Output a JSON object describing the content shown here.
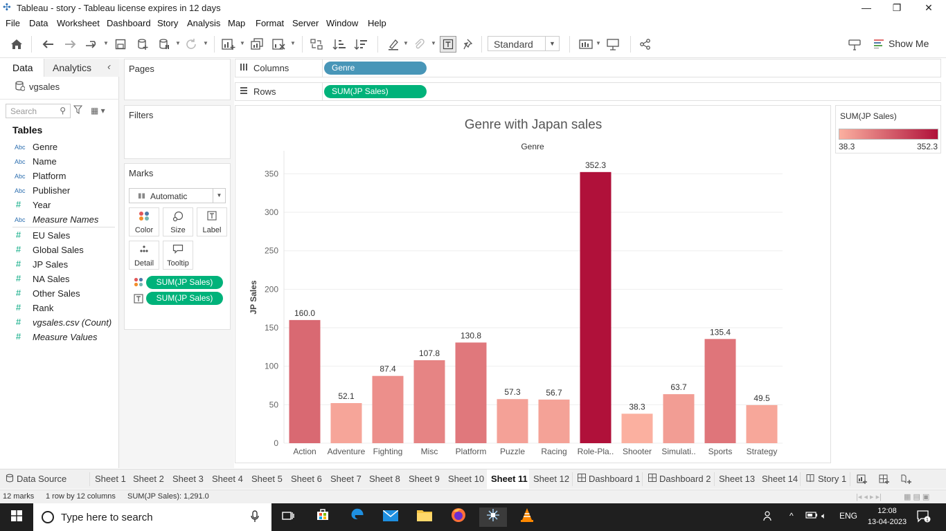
{
  "window": {
    "title": "Tableau - story - Tableau license expires in 12 days",
    "minimize": "—",
    "restore": "❐",
    "close": "✕"
  },
  "menu": [
    "File",
    "Data",
    "Worksheet",
    "Dashboard",
    "Story",
    "Analysis",
    "Map",
    "Format",
    "Server",
    "Window",
    "Help"
  ],
  "toolbar": {
    "view_size": "Standard",
    "show_me": "Show Me"
  },
  "data_pane": {
    "tab_data": "Data",
    "tab_analytics": "Analytics",
    "datasource": "vgsales",
    "search_placeholder": "Search",
    "tables_heading": "Tables",
    "fields": [
      {
        "type": "Abc",
        "name": "Genre"
      },
      {
        "type": "Abc",
        "name": "Name"
      },
      {
        "type": "Abc",
        "name": "Platform"
      },
      {
        "type": "Abc",
        "name": "Publisher"
      },
      {
        "type": "#",
        "name": "Year"
      },
      {
        "type": "Abc",
        "name": "Measure Names"
      },
      {
        "type": "#",
        "name": "EU Sales"
      },
      {
        "type": "#",
        "name": "Global Sales"
      },
      {
        "type": "#",
        "name": "JP Sales"
      },
      {
        "type": "#",
        "name": "NA Sales"
      },
      {
        "type": "#",
        "name": "Other Sales"
      },
      {
        "type": "#",
        "name": "Rank"
      },
      {
        "type": "#",
        "name": "vgsales.csv (Count)"
      },
      {
        "type": "#",
        "name": "Measure Values"
      }
    ]
  },
  "cards": {
    "pages": "Pages",
    "filters": "Filters",
    "marks": "Marks",
    "mark_type": "Automatic",
    "mark_buttons": [
      "Color",
      "Size",
      "Label",
      "Detail",
      "Tooltip"
    ],
    "mark_pills": [
      "SUM(JP Sales)",
      "SUM(JP Sales)"
    ]
  },
  "shelves": {
    "columns_label": "Columns",
    "columns_pill": "Genre",
    "rows_label": "Rows",
    "rows_pill": "SUM(JP Sales)"
  },
  "legend": {
    "title": "SUM(JP Sales)",
    "min": "38.3",
    "max": "352.3",
    "color_low": "#fbb0a0",
    "color_high": "#b0113a"
  },
  "chart_data": {
    "type": "bar",
    "title": "Genre with Japan sales",
    "xlabel": "Genre",
    "ylabel": "JP Sales",
    "categories": [
      "Action",
      "Adventure",
      "Fighting",
      "Misc",
      "Platform",
      "Puzzle",
      "Racing",
      "Role-Pla..",
      "Shooter",
      "Simulati..",
      "Sports",
      "Strategy"
    ],
    "values": [
      160.0,
      52.1,
      87.4,
      107.8,
      130.8,
      57.3,
      56.7,
      352.3,
      38.3,
      63.7,
      135.4,
      49.5
    ],
    "value_labels": [
      "160.0",
      "52.1",
      "87.4",
      "107.8",
      "130.8",
      "57.3",
      "56.7",
      "352.3",
      "38.3",
      "63.7",
      "135.4",
      "49.5"
    ],
    "yticks": [
      0,
      50,
      100,
      150,
      200,
      250,
      300,
      350
    ],
    "ylim": [
      0,
      380
    ],
    "gridlines": true
  },
  "sheet_tabs": [
    {
      "label": "Data Source",
      "icon": "db"
    },
    {
      "label": "Sheet 1"
    },
    {
      "label": "Sheet 2"
    },
    {
      "label": "Sheet 3"
    },
    {
      "label": "Sheet 4"
    },
    {
      "label": "Sheet 5"
    },
    {
      "label": "Sheet 6"
    },
    {
      "label": "Sheet 7"
    },
    {
      "label": "Sheet 8"
    },
    {
      "label": "Sheet 9"
    },
    {
      "label": "Sheet 10"
    },
    {
      "label": "Sheet 11",
      "active": true
    },
    {
      "label": "Sheet 12"
    },
    {
      "label": "Dashboard 1",
      "icon": "dash"
    },
    {
      "label": "Dashboard 2",
      "icon": "dash"
    },
    {
      "label": "Sheet 13"
    },
    {
      "label": "Sheet 14"
    },
    {
      "label": "Story 1",
      "icon": "story"
    }
  ],
  "status": {
    "marks": "12 marks",
    "dims": "1 row by 12 columns",
    "sum": "SUM(JP Sales): 1,291.0"
  },
  "taskbar": {
    "search_placeholder": "Type here to search",
    "lang": "ENG",
    "time": "12:08",
    "date": "13-04-2023",
    "notifications": "1"
  }
}
